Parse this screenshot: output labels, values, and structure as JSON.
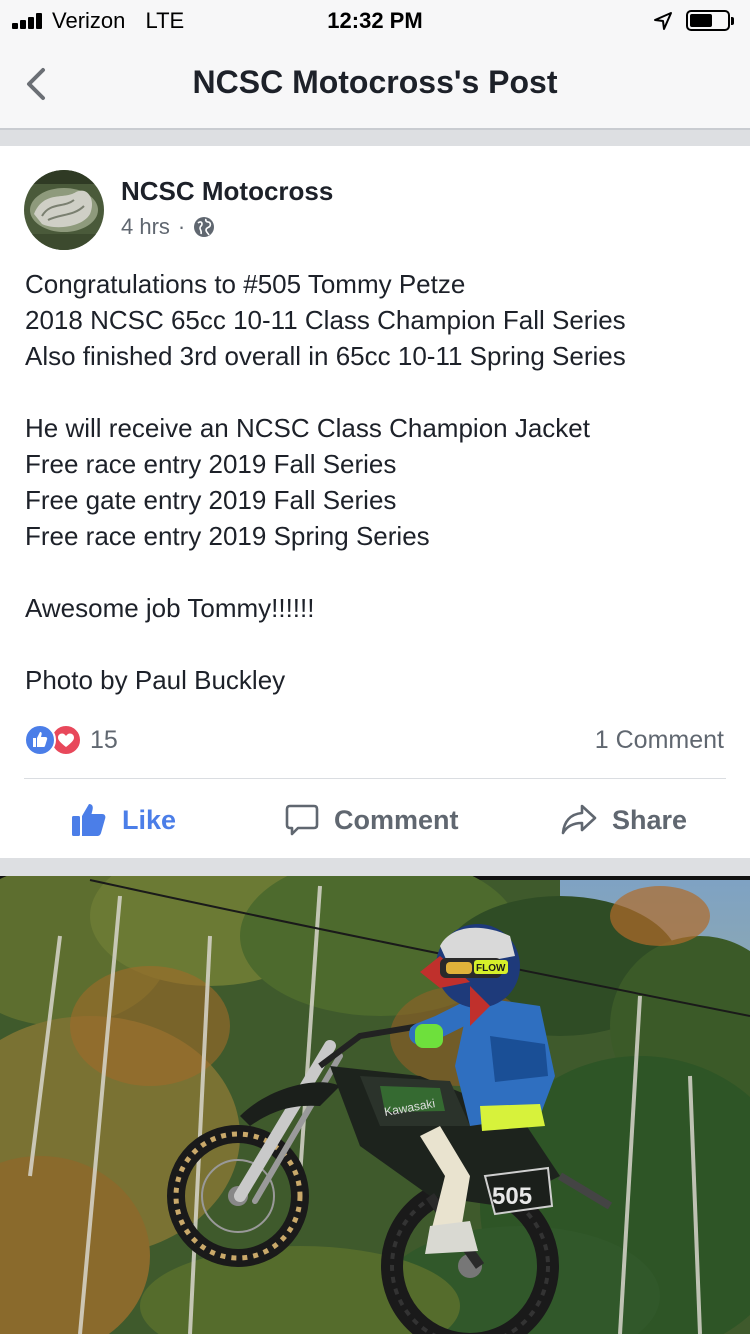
{
  "status_bar": {
    "carrier": "Verizon",
    "network": "LTE",
    "time": "12:32 PM"
  },
  "nav": {
    "title": "NCSC Motocross's Post",
    "back_icon": "chevron-left-icon"
  },
  "post": {
    "author": "NCSC Motocross",
    "time_ago": "4 hrs",
    "separator": "·",
    "privacy_icon": "globe-icon",
    "lines": [
      "Congratulations to #505 Tommy Petze",
      "2018 NCSC 65cc 10-11 Class Champion Fall Series",
      "Also finished 3rd overall in 65cc 10-11 Spring Series",
      "",
      "He will receive an NCSC Class Champion Jacket",
      "Free race entry 2019 Fall Series",
      "Free gate entry 2019 Fall Series",
      "Free race entry 2019 Spring Series",
      "",
      "Awesome job Tommy!!!!!!",
      "",
      "Photo by Paul Buckley"
    ],
    "reaction_count": "15",
    "comment_count": "1 Comment",
    "actions": {
      "like": "Like",
      "comment": "Comment",
      "share": "Share"
    }
  },
  "photo": {
    "bike_brand": "Kawasaki",
    "number_plate": "505",
    "goggle_brand": "FLOW"
  },
  "colors": {
    "accent": "#4b7ee8",
    "love": "#e8485b",
    "text": "#1d2129",
    "muted": "#606770",
    "separator": "#dddfe2"
  }
}
